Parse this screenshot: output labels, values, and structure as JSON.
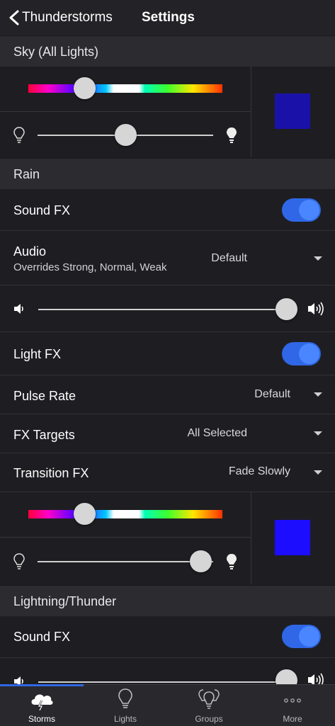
{
  "header": {
    "back_label": "Thunderstorms",
    "title": "Settings"
  },
  "sky": {
    "section_label": "Sky (All Lights)",
    "hue_fraction": 0.29,
    "brightness_fraction": 0.5,
    "swatch_color": "#1a12a8"
  },
  "rain": {
    "section_label": "Rain",
    "sound_fx": {
      "label": "Sound FX",
      "on": true
    },
    "audio": {
      "label": "Audio",
      "sublabel": "Overrides Strong, Normal, Weak",
      "value": "Default"
    },
    "volume_fraction": 1.0,
    "light_fx": {
      "label": "Light FX",
      "on": true
    },
    "pulse_rate": {
      "label": "Pulse Rate",
      "value": "Default"
    },
    "fx_targets": {
      "label": "FX Targets",
      "value": "All Selected"
    },
    "transition_fx": {
      "label": "Transition FX",
      "value": "Fade Slowly"
    },
    "hue_fraction": 0.29,
    "brightness_fraction": 0.93,
    "swatch_color": "#1c0dff"
  },
  "lightning": {
    "section_label": "Lightning/Thunder",
    "sound_fx": {
      "label": "Sound FX",
      "on": true
    },
    "volume_fraction": 1.0
  },
  "tabs": [
    {
      "label": "Storms",
      "icon": "storm-cloud-icon",
      "active": true
    },
    {
      "label": "Lights",
      "icon": "bulb-icon",
      "active": false
    },
    {
      "label": "Groups",
      "icon": "bulbs-group-icon",
      "active": false
    },
    {
      "label": "More",
      "icon": "more-dots-icon",
      "active": false
    }
  ],
  "colors": {
    "accent": "#2f67e6",
    "toggle_thumb": "#4a86ff",
    "background": "#1e1e22",
    "section": "#2b2b30"
  }
}
